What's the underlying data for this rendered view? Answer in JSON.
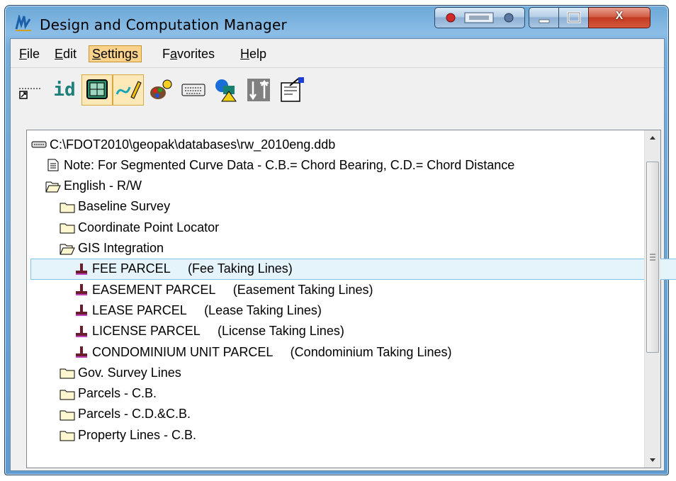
{
  "window": {
    "title": "Design and Computation Manager",
    "close_label": "X"
  },
  "menu": {
    "items": [
      {
        "label": "File",
        "mnemonic": "F"
      },
      {
        "label": "Edit",
        "mnemonic": "E"
      },
      {
        "label": "Settings",
        "mnemonic": "S",
        "active": true
      },
      {
        "label": "Favorites",
        "mnemonic": "a"
      },
      {
        "label": "Help",
        "mnemonic": "H"
      }
    ]
  },
  "toolbar": {
    "id_label": "id",
    "tools": [
      "place-tool-icon",
      "id-tool-icon",
      "display-tool-icon",
      "design-draw-icon",
      "palette-icon",
      "keyboard-icon",
      "shapes-icon",
      "matchline-icon",
      "settings-icon"
    ]
  },
  "tree": {
    "items": [
      {
        "level": 0,
        "icon": "database-icon",
        "text": "C:\\FDOT2010\\geopak\\databases\\rw_2010eng.ddb"
      },
      {
        "level": 1,
        "icon": "note-icon",
        "text": "Note: For Segmented Curve Data - C.B.= Chord Bearing, C.D.= Chord Distance"
      },
      {
        "level": 1,
        "icon": "folder-open-icon",
        "text": "English - R/W"
      },
      {
        "level": 2,
        "icon": "folder-icon",
        "text": "Baseline Survey"
      },
      {
        "level": 2,
        "icon": "folder-icon",
        "text": "Coordinate Point Locator"
      },
      {
        "level": 2,
        "icon": "folder-open-icon",
        "text": "GIS Integration"
      },
      {
        "level": 3,
        "icon": "item-icon",
        "text": "FEE PARCEL     (Fee Taking Lines)",
        "selected": true
      },
      {
        "level": 3,
        "icon": "item-icon",
        "text": "EASEMENT PARCEL     (Easement Taking Lines)"
      },
      {
        "level": 3,
        "icon": "item-icon",
        "text": "LEASE PARCEL     (Lease Taking Lines)"
      },
      {
        "level": 3,
        "icon": "item-icon",
        "text": "LICENSE PARCEL     (License Taking Lines)"
      },
      {
        "level": 3,
        "icon": "item-icon",
        "text": "CONDOMINIUM UNIT PARCEL     (Condominium Taking Lines)"
      },
      {
        "level": 2,
        "icon": "folder-icon",
        "text": "Gov. Survey Lines"
      },
      {
        "level": 2,
        "icon": "folder-icon",
        "text": "Parcels - C.B."
      },
      {
        "level": 2,
        "icon": "folder-icon",
        "text": "Parcels - C.D.&C.B."
      },
      {
        "level": 2,
        "icon": "folder-icon",
        "text": "Property Lines - C.B."
      }
    ]
  },
  "colors": {
    "selection_bg": "#e5f3fb",
    "menu_active": "#fbd28c",
    "item_icon": "#6b1d2e"
  }
}
